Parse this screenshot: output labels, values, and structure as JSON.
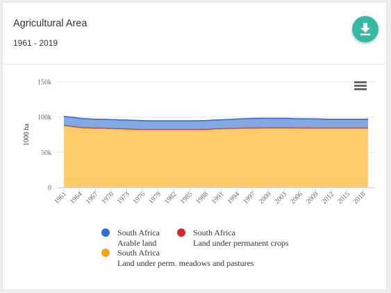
{
  "header": {
    "title": "Agricultural Area",
    "subtitle": "1961 - 2019"
  },
  "icons": {
    "download": "download-icon",
    "menu": "hamburger-menu-icon"
  },
  "chart_data": {
    "type": "area",
    "stacked": true,
    "ylabel": "1000 ha",
    "ylim": [
      0,
      150000
    ],
    "yticks": [
      0,
      50000,
      100000,
      150000
    ],
    "ytick_labels": [
      "0",
      "50k",
      "100k",
      "150k"
    ],
    "x": [
      1961,
      1962,
      1963,
      1964,
      1965,
      1966,
      1967,
      1968,
      1969,
      1970,
      1971,
      1972,
      1973,
      1974,
      1975,
      1976,
      1977,
      1978,
      1979,
      1980,
      1981,
      1982,
      1983,
      1984,
      1985,
      1986,
      1987,
      1988,
      1989,
      1990,
      1991,
      1992,
      1993,
      1994,
      1995,
      1996,
      1997,
      1998,
      1999,
      2000,
      2001,
      2002,
      2003,
      2004,
      2005,
      2006,
      2007,
      2008,
      2009,
      2010,
      2011,
      2012,
      2013,
      2014,
      2015,
      2016,
      2017,
      2018,
      2019
    ],
    "xtick_labels": [
      "1961",
      "1964",
      "1967",
      "1970",
      "1973",
      "1976",
      "1979",
      "1982",
      "1985",
      "1988",
      "1991",
      "1994",
      "1997",
      "2000",
      "2003",
      "2006",
      "2009",
      "2012",
      "2015",
      "2018"
    ],
    "series": [
      {
        "name": "South Africa",
        "sub": "Land under perm. meadows and pastures",
        "color": "#ffc65c",
        "stroke": "#f7a21b",
        "values": [
          88000,
          87000,
          86000,
          85000,
          84500,
          84500,
          84000,
          84000,
          83800,
          83500,
          83300,
          83000,
          82800,
          82500,
          82300,
          82000,
          82000,
          82000,
          82000,
          82000,
          82000,
          82000,
          82000,
          82000,
          82000,
          82000,
          82000,
          82200,
          82500,
          83000,
          83200,
          83500,
          83600,
          83800,
          84000,
          84200,
          84300,
          84400,
          84500,
          84500,
          84500,
          84500,
          84500,
          84500,
          84400,
          84400,
          84300,
          84200,
          84200,
          84200,
          84200,
          84200,
          84200,
          84200,
          84200,
          84200,
          84200,
          84200,
          84200
        ]
      },
      {
        "name": "South Africa",
        "sub": "Land under permanent crops",
        "color": "#d1282c",
        "stroke": "#d1282c",
        "values": [
          600,
          600,
          600,
          600,
          600,
          600,
          600,
          600,
          600,
          600,
          600,
          600,
          600,
          600,
          600,
          600,
          600,
          600,
          600,
          600,
          600,
          600,
          600,
          600,
          600,
          600,
          600,
          600,
          600,
          600,
          600,
          600,
          600,
          600,
          600,
          600,
          600,
          600,
          600,
          600,
          600,
          600,
          600,
          600,
          600,
          600,
          600,
          600,
          600,
          600,
          600,
          600,
          600,
          600,
          600,
          600,
          600,
          600,
          600
        ]
      },
      {
        "name": "South Africa",
        "sub": "Arable land",
        "color": "#6f99dd",
        "stroke": "#3366cc",
        "values": [
          12400,
          12700,
          12900,
          12700,
          12700,
          12400,
          12400,
          12400,
          12400,
          12400,
          12400,
          12400,
          12400,
          12400,
          12400,
          12400,
          12200,
          12200,
          12200,
          12200,
          12200,
          12100,
          12100,
          12100,
          12100,
          12100,
          12300,
          12300,
          12400,
          12400,
          12400,
          12400,
          12600,
          12900,
          13000,
          13100,
          13300,
          13300,
          13300,
          13200,
          13200,
          13200,
          13200,
          13100,
          12800,
          12700,
          12800,
          12800,
          12800,
          12500,
          12200,
          12200,
          12200,
          12200,
          12200,
          12200,
          12200,
          12200,
          12200
        ]
      }
    ],
    "legend": [
      {
        "name": "South Africa",
        "sub": "Arable land",
        "color": "#2f6fd4"
      },
      {
        "name": "South Africa",
        "sub": "Land under permanent crops",
        "color": "#d1282c"
      },
      {
        "name": "South Africa",
        "sub": "Land under perm. meadows and pastures",
        "color": "#f7a21b"
      }
    ]
  }
}
